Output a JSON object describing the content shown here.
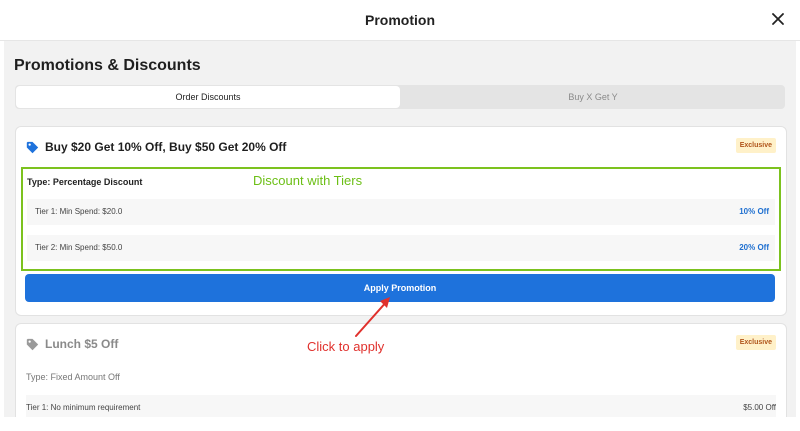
{
  "header": {
    "title": "Promotion"
  },
  "page": {
    "title": "Promotions & Discounts"
  },
  "tabs": [
    {
      "label": "Order Discounts",
      "active": true
    },
    {
      "label": "Buy X Get Y",
      "active": false
    }
  ],
  "promotions": [
    {
      "title": "Buy $20 Get 10% Off, Buy $50 Get 20% Off",
      "badge": "Exclusive",
      "type": "Type: Percentage Discount",
      "tiers": [
        {
          "label": "Tier 1: Min Spend: $20.0",
          "value": "10% Off"
        },
        {
          "label": "Tier 2: Min Spend: $50.0",
          "value": "20% Off"
        }
      ],
      "apply_label": "Apply Promotion"
    },
    {
      "title": "Lunch $5 Off",
      "badge": "Exclusive",
      "type": "Type: Fixed Amount Off",
      "tiers": [
        {
          "label": "Tier 1: No minimum requirement",
          "value": "$5.00 Off"
        }
      ]
    }
  ],
  "annotations": {
    "tiers_note": "Discount with Tiers",
    "click_note": "Click to apply"
  },
  "colors": {
    "accent": "#1e72dc",
    "annotation_green": "#7cc21e",
    "annotation_red": "#e0312d",
    "badge_bg": "#fff1c9",
    "badge_text": "#b0541a"
  },
  "icons": {
    "close": "close-icon",
    "tag": "tag-icon"
  }
}
